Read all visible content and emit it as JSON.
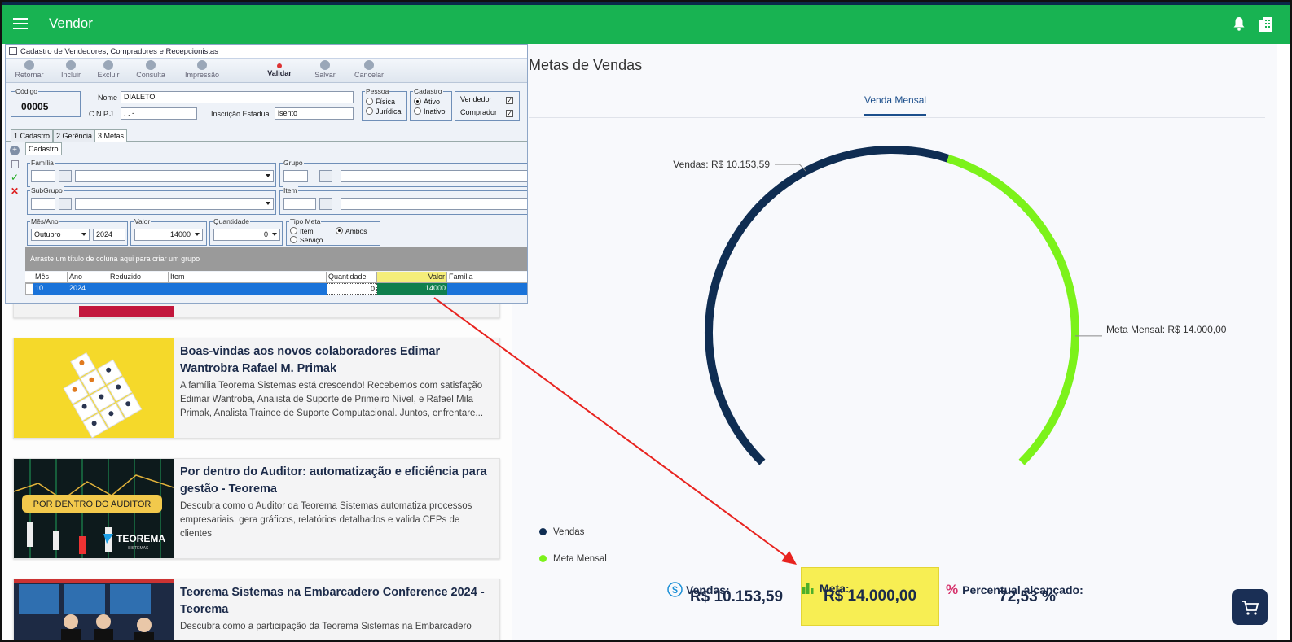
{
  "app": {
    "title": "Vendor"
  },
  "news": {
    "cards": [
      {
        "title": "Boas-vindas aos novos colaboradores Edimar Wantrobra Rafael M. Primak",
        "description": "A família Teorema Sistemas está crescendo! Recebemos com satisfação Edimar Wantroba, Analista de Suporte de Primeiro Nível, e Rafael Mila Primak, Analista Trainee de Suporte Computacional. Juntos, enfrentare..."
      },
      {
        "title": "Por dentro do Auditor: automatização e eficiência para gestão - Teorema",
        "description": "Descubra como o Auditor da Teorema Sistemas automatiza processos empresariais, gera gráficos, relatórios detalhados e valida CEPs de clientes",
        "thumb_badge": "POR DENTRO DO AUDITOR",
        "thumb_brand": "TEOREMA",
        "thumb_brand_sub": "SISTEMAS"
      },
      {
        "title": "Teorema Sistemas na Embarcadero Conference 2024 - Teorema",
        "description": "Descubra como a participação da Teorema Sistemas na Embarcadero"
      }
    ]
  },
  "dashboard": {
    "title": "Metas de Vendas",
    "tab": "Venda Mensal",
    "gauge": {
      "sales_label": "Vendas: R$ 10.153,59",
      "goal_label": "Meta Mensal: R$ 14.000,00",
      "sales_value": 10153.59,
      "goal_value": 14000.0,
      "sales_color": "#0f2d52",
      "goal_color": "#7cf21a"
    },
    "legend": [
      {
        "label": "Vendas",
        "color": "#0f2d52"
      },
      {
        "label": "Meta Mensal",
        "color": "#7cf21a"
      }
    ],
    "stats": {
      "vendas_label": "Vendas:",
      "vendas_value": "R$ 10.153,59",
      "meta_label": "Meta:",
      "meta_value": "R$ 14.000,00",
      "percent_label": "Percentual alcançado:",
      "percent_value": "72,53 %"
    },
    "accent_color": "#1c4f8c"
  },
  "legacy_window": {
    "title": "Cadastro de Vendedores, Compradores e Recepcionistas",
    "toolbar": [
      "Retornar",
      "Incluir",
      "Excluir",
      "Consulta",
      "Impressão",
      "Validar",
      "Salvar",
      "Cancelar"
    ],
    "codigo_label": "Código",
    "codigo": "00005",
    "nome_label": "Nome",
    "nome": "DIALETO",
    "cnpj_label": "C.N.P.J.",
    "cnpj": ". . -",
    "ie_label": "Inscrição Estadual",
    "ie": "isento",
    "pessoa_label": "Pessoa",
    "pessoa_fisica": "Física",
    "pessoa_juridica": "Jurídica",
    "cadastro_label": "Cadastro",
    "ativo": "Ativo",
    "inativo": "Inativo",
    "vendedor": "Vendedor",
    "comprador": "Comprador",
    "tabs": [
      "1 Cadastro",
      "2 Gerência",
      "3 Metas"
    ],
    "subtab": "Cadastro",
    "familia_label": "Família",
    "grupo_label": "Grupo",
    "subgrupo_label": "SubGrupo",
    "item_label": "Item",
    "mesano_label": "Mês/Ano",
    "mes": "Outubro",
    "ano": "2024",
    "valor_label": "Valor",
    "valor": "14000",
    "quantidade_label": "Quantidade",
    "quantidade": "0",
    "tipo_meta_label": "Tipo Meta",
    "tipo_item": "Item",
    "tipo_servico": "Serviço",
    "tipo_ambos": "Ambos",
    "group_hint": "Arraste um título de coluna aqui para criar um grupo",
    "grid_headers": [
      "Mês",
      "Ano",
      "Reduzido",
      "Item",
      "Quantidade",
      "Valor",
      "Família"
    ],
    "grid_row": [
      "10",
      "2024",
      "",
      "",
      "0",
      "14000",
      ""
    ]
  },
  "icons": {
    "menu": "menu-icon",
    "bell": "bell-icon",
    "building": "building-icon",
    "cart": "cart-icon",
    "dollar": "dollar-circle-icon",
    "bar_chart": "bar-chart-icon",
    "percent": "percent-icon"
  }
}
